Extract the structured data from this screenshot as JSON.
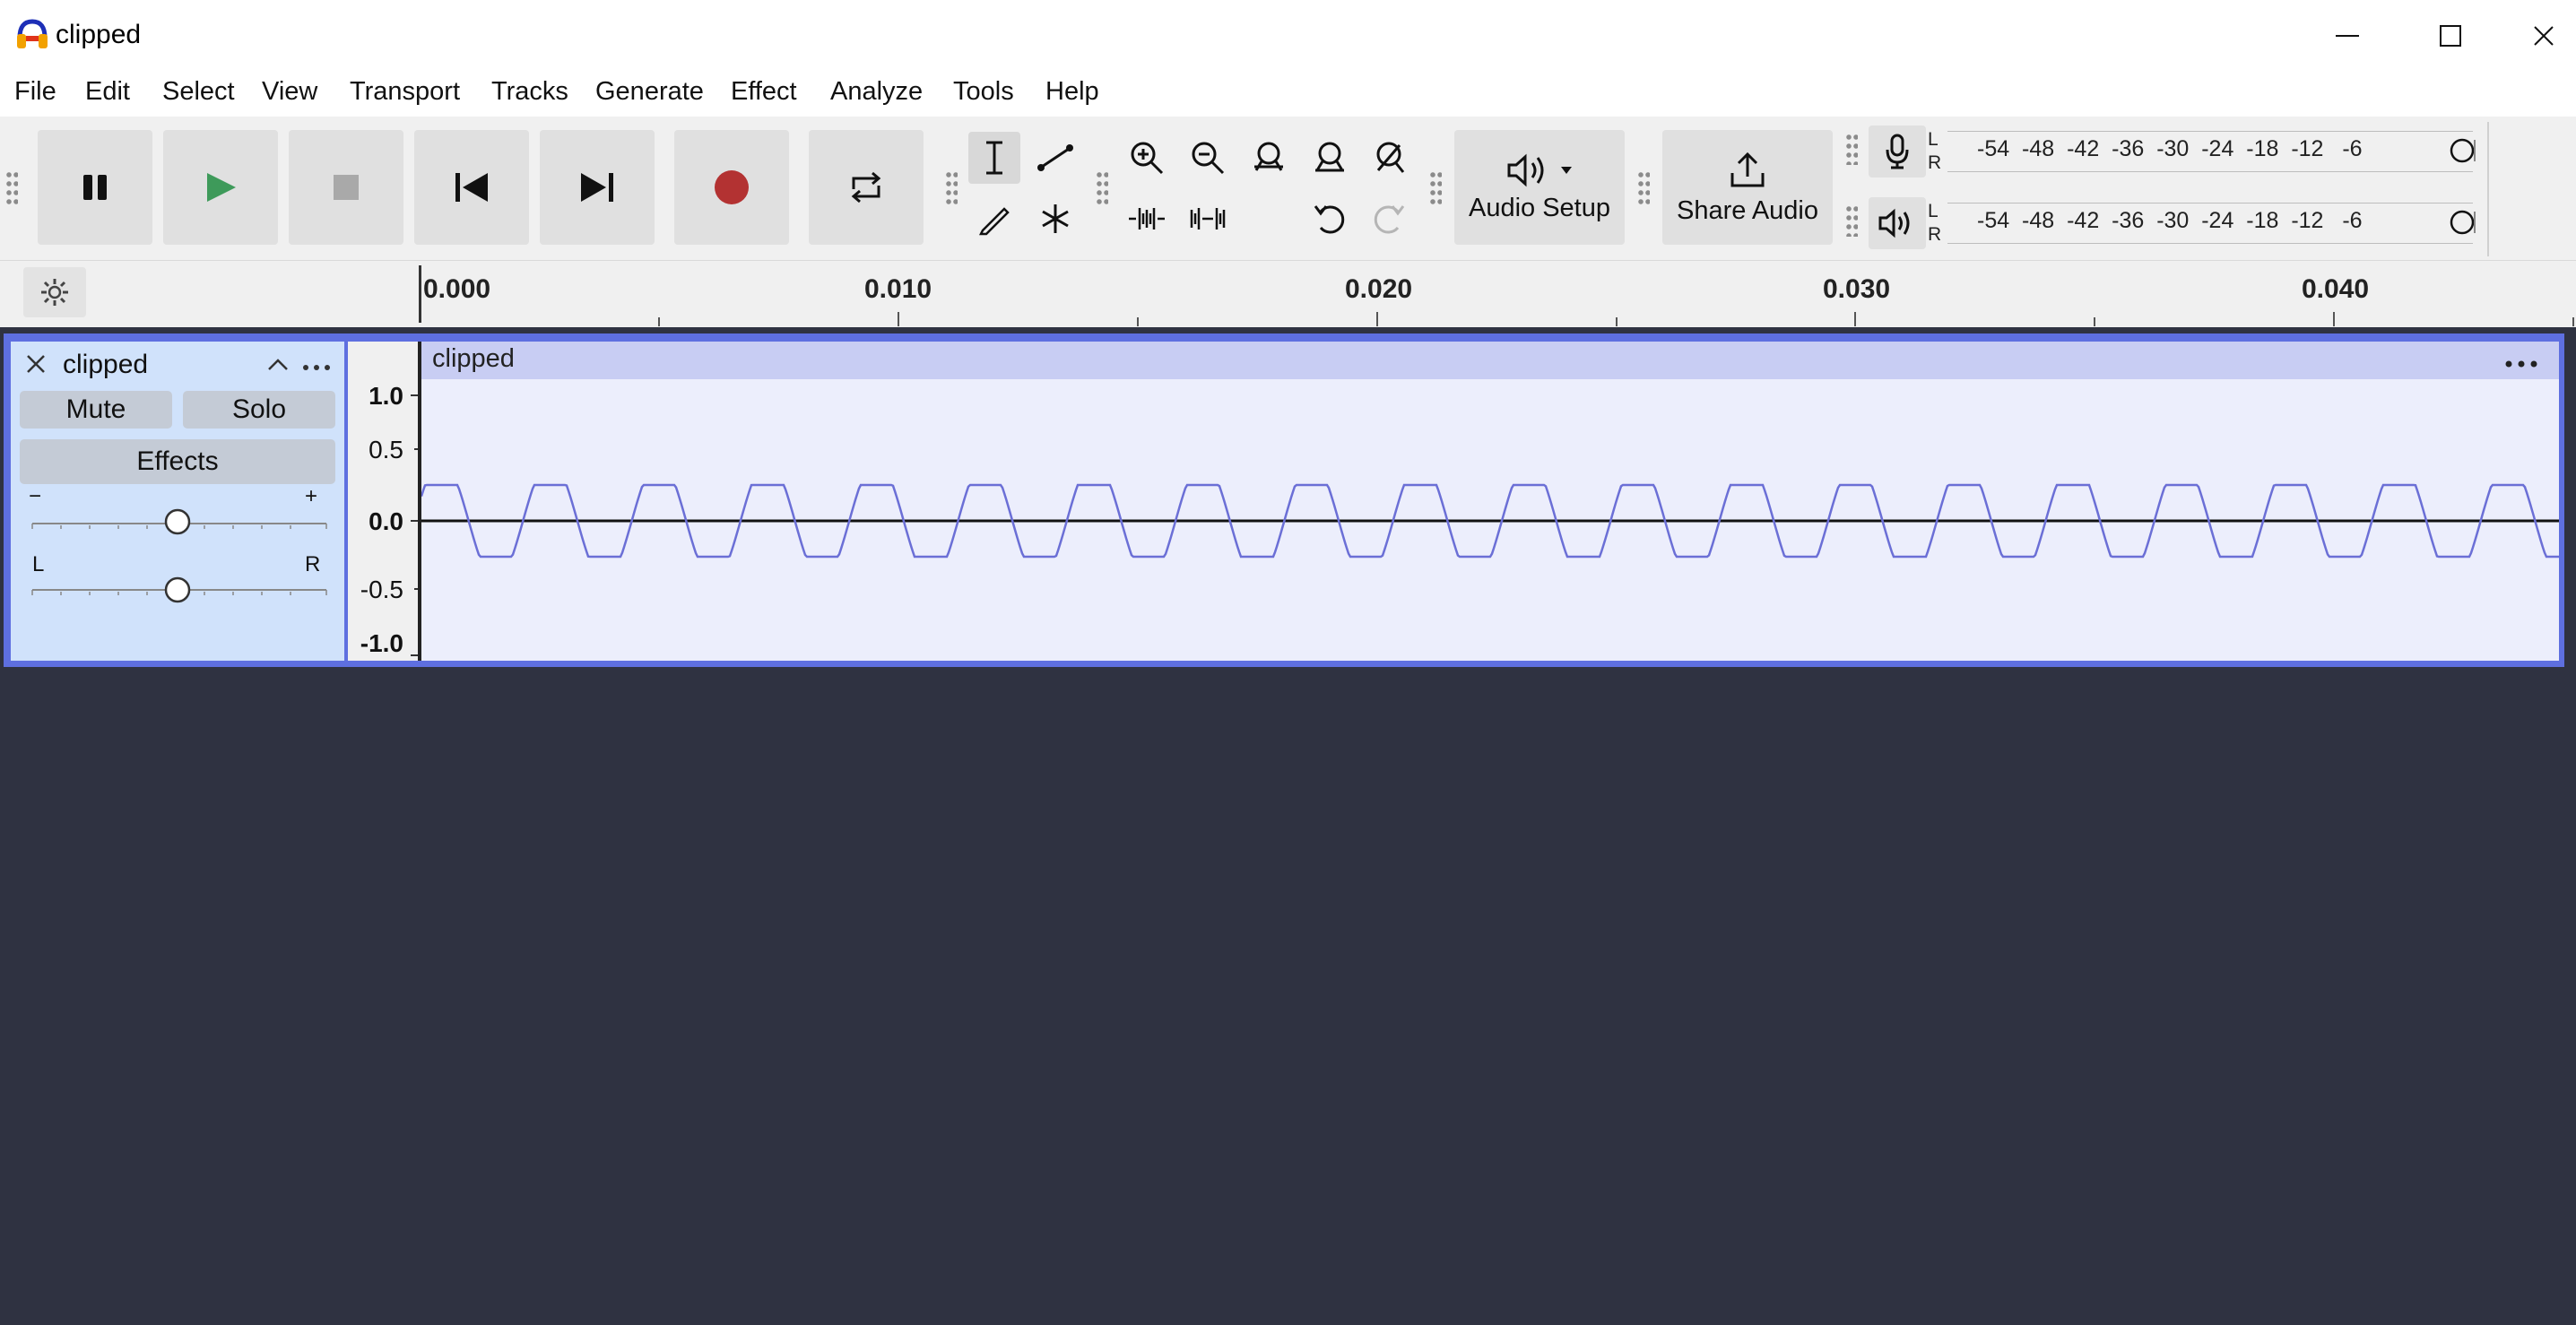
{
  "window": {
    "title": "clipped"
  },
  "menu": [
    "File",
    "Edit",
    "Select",
    "View",
    "Transport",
    "Tracks",
    "Generate",
    "Effect",
    "Analyze",
    "Tools",
    "Help"
  ],
  "toolbar": {
    "audio_setup_label": "Audio Setup",
    "share_audio_label": "Share Audio"
  },
  "meters": {
    "record": {
      "l": "L",
      "r": "R",
      "scale": [
        "-54",
        "-48",
        "-42",
        "-36",
        "-30",
        "-24",
        "-18",
        "-12",
        "-6"
      ]
    },
    "playback": {
      "l": "L",
      "r": "R",
      "scale": [
        "-54",
        "-48",
        "-42",
        "-36",
        "-30",
        "-24",
        "-18",
        "-12",
        "-6"
      ]
    }
  },
  "ruler": {
    "labels": [
      "0.000",
      "0.010",
      "0.020",
      "0.030",
      "0.040"
    ]
  },
  "track": {
    "name": "clipped",
    "mute_label": "Mute",
    "solo_label": "Solo",
    "effects_label": "Effects",
    "gain_minus": "−",
    "gain_plus": "+",
    "pan_left": "L",
    "pan_right": "R",
    "clip_name": "clipped",
    "vruler": [
      "1.0",
      "0.5",
      "0.0",
      "-0.5",
      "-1.0"
    ]
  },
  "colors": {
    "record_red": "#c0392b",
    "play_green": "#3e9a5a",
    "waveform": "#6b6fd6",
    "track_border": "#5e6fe0",
    "background": "#2f3241"
  }
}
